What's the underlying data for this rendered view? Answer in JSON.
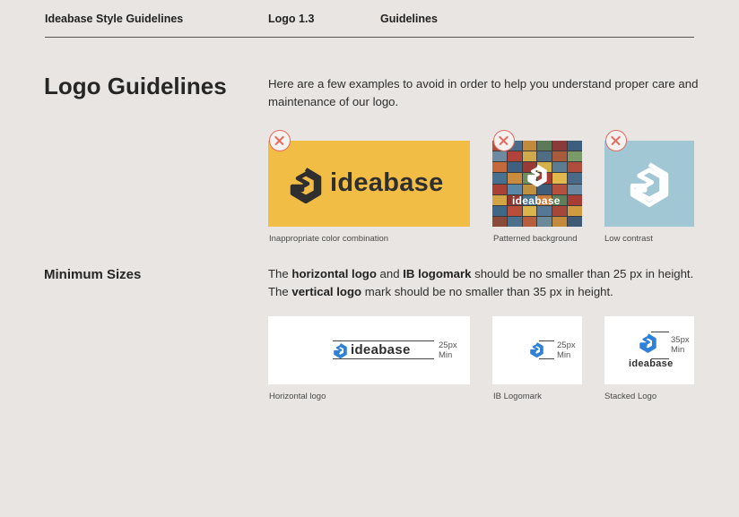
{
  "header": {
    "site_title": "Ideabase Style Guidelines",
    "section": "Logo 1.3",
    "page": "Guidelines"
  },
  "logo_guidelines": {
    "heading": "Logo Guidelines",
    "intro": "Here are a few examples to avoid in order to help you understand proper care and maintenance of our logo.",
    "examples": [
      {
        "caption": "Inappropriate color combination",
        "logo_text": "ideabase",
        "background": "#f2bd44"
      },
      {
        "caption": "Patterned background",
        "logo_text": "ideabase"
      },
      {
        "caption": "Low contrast",
        "background": "#a1c6d4"
      }
    ]
  },
  "minimum_sizes": {
    "heading": "Minimum Sizes",
    "line1": {
      "pre": "The ",
      "b1": "horizontal logo",
      "mid1": " and ",
      "b2": "IB logomark",
      "post": " should be no smaller than 25 px in height."
    },
    "line2": {
      "pre": "The ",
      "b1": "vertical logo",
      "post": " mark should be no smaller than 35 px in height."
    },
    "examples": [
      {
        "caption": "Horizontal logo",
        "logo_text": "ideabase",
        "size": "25px",
        "min": "Min"
      },
      {
        "caption": "IB Logomark",
        "size": "25px",
        "min": "Min"
      },
      {
        "caption": "Stacked Logo",
        "logo_text": "ideabase",
        "size": "35px",
        "min": "Min"
      }
    ]
  },
  "colors": {
    "brand_blue": "#2f80d8",
    "dark_mark": "#2f2f2f",
    "error_red": "#e36a5e"
  }
}
